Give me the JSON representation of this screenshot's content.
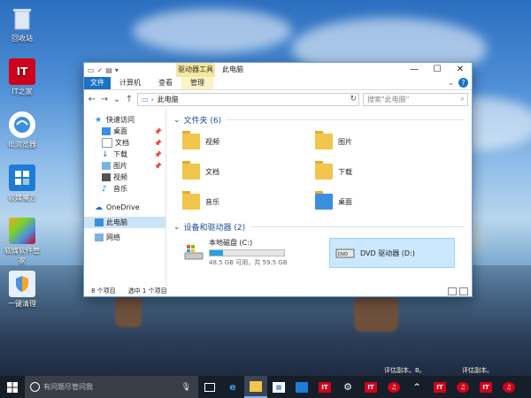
{
  "desktop": {
    "icons": [
      {
        "label": "回收站",
        "icon": "recycle-bin-icon",
        "color": "#9bb7d9"
      },
      {
        "label": "IT之家",
        "icon": "ithome-icon",
        "color": "#d0021b",
        "glyph": "IT"
      },
      {
        "label": "IE浏览器",
        "icon": "browser-icon",
        "color": "#3b8ee0"
      },
      {
        "label": "软媒魔方",
        "icon": "cube-icon",
        "color": "#1f7bd8"
      },
      {
        "label": "软媒软件管家",
        "icon": "software-manager-icon",
        "color": "#f5a623"
      },
      {
        "label": "一键清理",
        "icon": "shield-icon",
        "color": "#e6f0ff"
      }
    ],
    "watermarks": [
      "评估副本。B。",
      "评估副本。"
    ]
  },
  "window": {
    "context_tab": "驱动器工具",
    "title": "此电脑",
    "ribbon_tabs": [
      "文件",
      "计算机",
      "查看",
      "管理"
    ],
    "address": "此电脑",
    "search_placeholder": "搜索\"此电脑\"",
    "nav": {
      "quick_access": "快速访问",
      "quick_items": [
        "桌面",
        "文档",
        "下载",
        "图片",
        "视频",
        "音乐"
      ],
      "onedrive": "OneDrive",
      "this_pc": "此电脑",
      "network": "网络"
    },
    "folders_header": "文件夹 (6)",
    "folders": [
      "视频",
      "图片",
      "文档",
      "下载",
      "音乐",
      "桌面"
    ],
    "drives_header": "设备和驱动器 (2)",
    "drives": [
      {
        "name": "本地磁盘 (C:)",
        "space": "48.5 GB 可用，共 59.5 GB",
        "used_fraction": 0.18
      },
      {
        "name": "DVD 驱动器 (D:)"
      }
    ],
    "status": {
      "count": "8 个项目",
      "selected": "选中 1 个项目"
    }
  },
  "taskbar": {
    "search_placeholder": "有问题尽管问我",
    "accent": "#7cb5ec"
  }
}
